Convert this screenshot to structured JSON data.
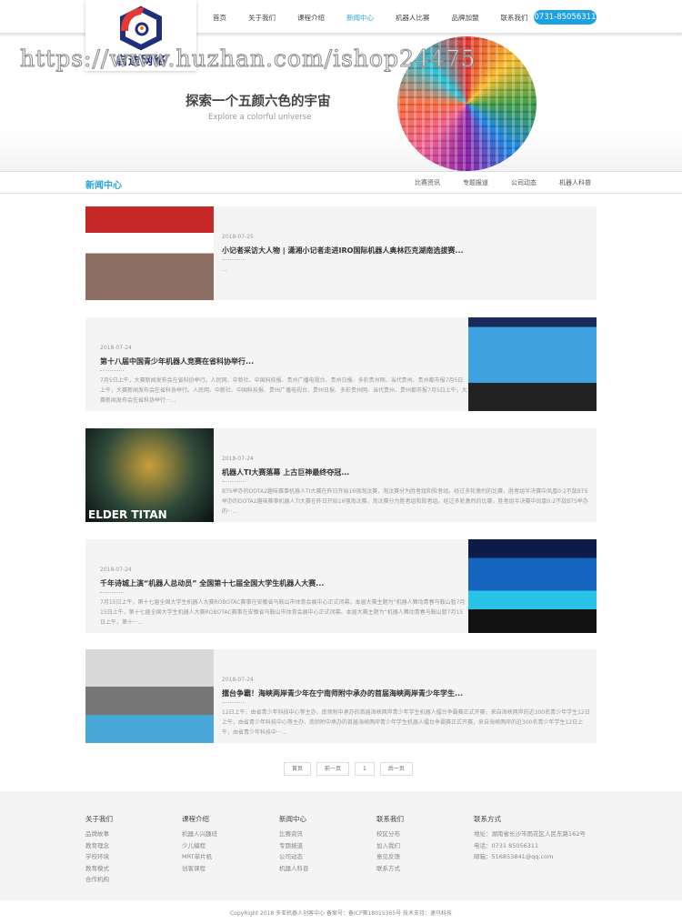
{
  "header": {
    "logo_text": "启迪网络",
    "nav": [
      "首页",
      "关于我们",
      "课程介绍",
      "新闻中心",
      "机器人比赛",
      "品牌加盟",
      "联系我们"
    ],
    "active_index": 3,
    "phone": "0731-85056311"
  },
  "watermark": "https://www.huzhan.com/ishop24475",
  "banner": {
    "slogan": "探索一个五颜六色的宇宙",
    "slogan_en": "Explore a colorful universe"
  },
  "subnav": {
    "title": "新闻中心",
    "links": [
      "比赛资讯",
      "专题报道",
      "公司动态",
      "机器人科普"
    ]
  },
  "articles": [
    {
      "date": "2018-07-25",
      "title": "小记者采访大人物 | 潇湘小记者走进IRO国际机器人奥林匹克湖南选拔赛...",
      "desc": "...",
      "image": "children-at-robot-contest-banner"
    },
    {
      "date": "2018-07-24",
      "title": "第十八届中国青少年机器人竞赛在省科协举行...",
      "desc": "7月5日上午，大赛新闻发布会在省科协举行。人民网、中新社、中国科技报、贵州广播电视台、贵州日报、多彩贵州网、当代贵州、贵州都市报7月5日上午，大赛新闻发布会在省科协举行。人民网、中新社、中国科技报、贵州广播电视台、贵州日报、多彩贵州网、当代贵州、贵州都市报7月5日上午，大赛新闻发布会在省科协举行···...",
      "image": "press-conference"
    },
    {
      "date": "2018-07-24",
      "title": "机器人TI大赛落幕 上古巨神最终夺冠...",
      "desc": "BTS举办的DOTA2趣味赛事机器人TI大赛在昨日开始16强淘汰赛，淘汰赛分为胜者组和败者组。经过多轮激烈的比赛，胜者组半决赛中凤凰0:2不敌BTS举办的DOTA2趣味赛事机器人TI大赛在昨日开始16强淘汰赛，淘汰赛分为胜者组和败者组。经过多轮激烈的比赛，胜者组半决赛中凤凰0:2不敌BTS举办的···...",
      "image": "elder-titan",
      "image_caption": "ELDER TITAN"
    },
    {
      "date": "2018-07-24",
      "title": "千年诗城上演“机器人总动员” 全国第十七届全国大学生机器人大赛...",
      "desc": "7月15日上午，第十七届全国大学生机器人大赛ROBOTAC赛事在安徽省马鞍山市体育会展中心正式闭幕。本届大赛主题为“机器人舞动青春马鞍山暂7月15日上午，第十七届全国大学生机器人大赛ROBOTAC赛事在安徽省马鞍山市体育会展中心正式闭幕。本届大赛主题为“机器人舞动青春马鞍山暂7月15日上午，第十···...",
      "image": "robot-arena"
    },
    {
      "date": "2018-07-24",
      "title": "擂台争霸！海峡两岸青少年在宁南师附中承办的首届海峡两岸青少年学生...",
      "desc": "12日上午，由省青少年科技中心等主办、南师附中承办的首届海峡两岸青少年学生机器人擂台争霸赛正式开赛，来自海峡两岸的近300名青少年学生12日上午，由省青少年科技中心等主办、南师附中承办的首届海峡两岸青少年学生机器人擂台争霸赛正式开赛，来自海峡两岸的近300名青少年学生12日上午，由省青少年科技中···...",
      "image": "robot-tank"
    }
  ],
  "pager": [
    "首页",
    "前一页",
    "1",
    "后一页"
  ],
  "footer": {
    "cols": [
      {
        "title": "关于我们",
        "links": [
          "品牌故事",
          "教育理念",
          "学校环境",
          "教育模式",
          "合作机构"
        ]
      },
      {
        "title": "课程介绍",
        "links": [
          "机器人兴趣班",
          "少儿编程",
          "MRT单片机",
          "创客课程"
        ]
      },
      {
        "title": "新闻中心",
        "links": [
          "比赛资讯",
          "专题报道",
          "公司动态",
          "机器人科普"
        ]
      },
      {
        "title": "联系我们",
        "links": [
          "校区分布",
          "加入我们",
          "意见反馈",
          "联系方式"
        ]
      },
      {
        "title": "联系方式",
        "links": [
          "地址：湖南省长沙市雨花区人民东路162号",
          "电话：0731 85056311",
          "邮箱：516853841@qq.com"
        ]
      }
    ],
    "copyright": "CopyRight 2018 多亚机器人创客中心 备案号：备ICP第18015365号 技术支持：速马科技"
  },
  "colors": {
    "accent": "#2aa5d8",
    "phone_bg": "#1da1e5"
  }
}
